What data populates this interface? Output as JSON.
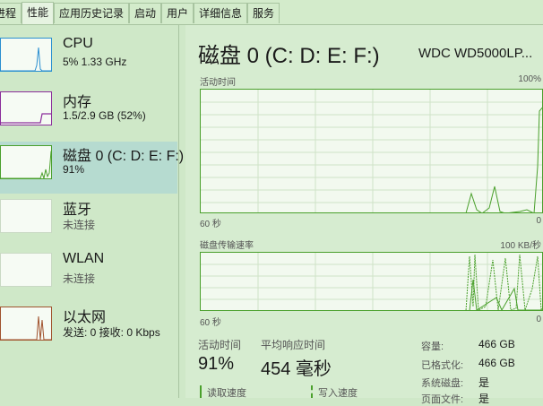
{
  "tabs": [
    "进程",
    "性能",
    "应用历史记录",
    "启动",
    "用户",
    "详细信息",
    "服务"
  ],
  "sidebar": {
    "items": [
      {
        "name": "CPU",
        "value": "5% 1.33 GHz"
      },
      {
        "name": "内存",
        "value": "1.5/2.9 GB (52%)"
      },
      {
        "name": "磁盘 0 (C: D: E: F:)",
        "value": "91%"
      },
      {
        "name": "蓝牙",
        "value": "未连接"
      },
      {
        "name": "WLAN",
        "value": "未连接"
      },
      {
        "name": "以太网",
        "value": "发送: 0 接收: 0 Kbps"
      }
    ]
  },
  "main": {
    "title": "磁盘 0 (C: D: E: F:)",
    "model": "WDC WD5000LP...",
    "graph1": {
      "label": "活动时间",
      "max": "100%",
      "time": "60 秒",
      "min": "0"
    },
    "graph2": {
      "label": "磁盘传输速率",
      "max": "100 KB/秒",
      "time": "60 秒",
      "min": "0"
    },
    "stats": [
      {
        "label": "活动时间",
        "value": "91%"
      },
      {
        "label": "平均响应时间",
        "value": "454 毫秒"
      }
    ],
    "legend": {
      "read": "读取速度",
      "write": "写入速度"
    },
    "props": [
      {
        "key": "容量:",
        "value": "466 GB"
      },
      {
        "key": "已格式化:",
        "value": "466 GB"
      },
      {
        "key": "系统磁盘:",
        "value": "是"
      },
      {
        "key": "页面文件:",
        "value": "是"
      }
    ]
  },
  "colors": {
    "accent": "#4aa02c",
    "memory": "#8b2d9b",
    "ethernet": "#a0522d",
    "selected": "#b6dbd0"
  }
}
